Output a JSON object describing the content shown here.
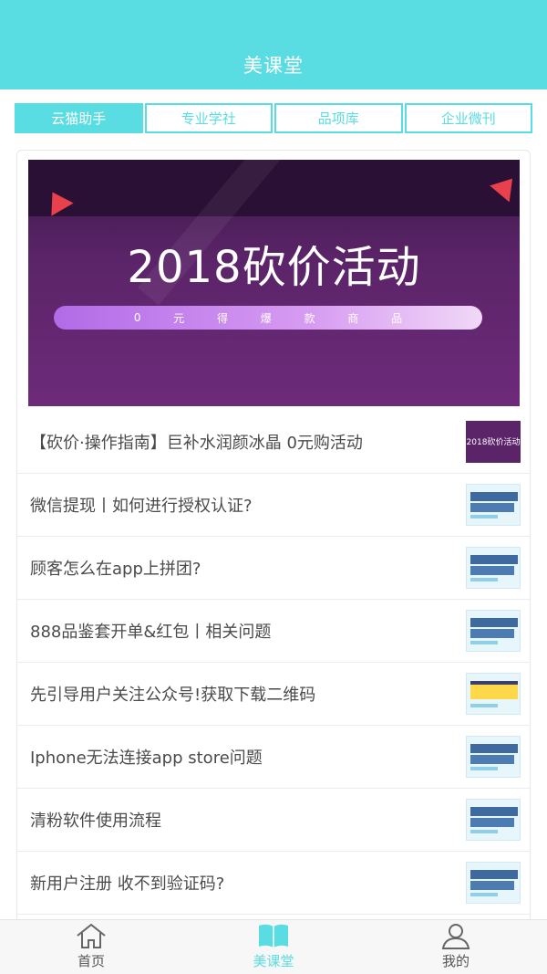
{
  "header": {
    "title": "美课堂"
  },
  "tabs": [
    {
      "label": "云猫助手",
      "active": true
    },
    {
      "label": "专业学社",
      "active": false
    },
    {
      "label": "品项库",
      "active": false
    },
    {
      "label": "企业微刊",
      "active": false
    }
  ],
  "banner": {
    "title": "2018砍价活动",
    "pill_chars": [
      "0",
      "元",
      "得",
      "爆",
      "款",
      "商",
      "品"
    ]
  },
  "articles": [
    {
      "title": "【砍价·操作指南】巨补水润颜冰晶 0元购活动",
      "thumb_text": "2018砍价活动"
    },
    {
      "title": "微信提现丨如何进行授权认证?"
    },
    {
      "title": "顾客怎么在app上拼团?"
    },
    {
      "title": "888品鉴套开单&红包丨相关问题"
    },
    {
      "title": "先引导用户关注公众号!获取下载二维码"
    },
    {
      "title": "Iphone无法连接app store问题"
    },
    {
      "title": "清粉软件使用流程"
    },
    {
      "title": "新用户注册 收不到验证码?"
    }
  ],
  "bottom_nav": [
    {
      "label": "首页",
      "icon": "home-icon",
      "active": false
    },
    {
      "label": "美课堂",
      "icon": "book-icon",
      "active": true
    },
    {
      "label": "我的",
      "icon": "user-icon",
      "active": false
    }
  ],
  "colors": {
    "accent": "#59dde2",
    "banner_bg": "#5b2468",
    "text": "#4a4a4a"
  }
}
